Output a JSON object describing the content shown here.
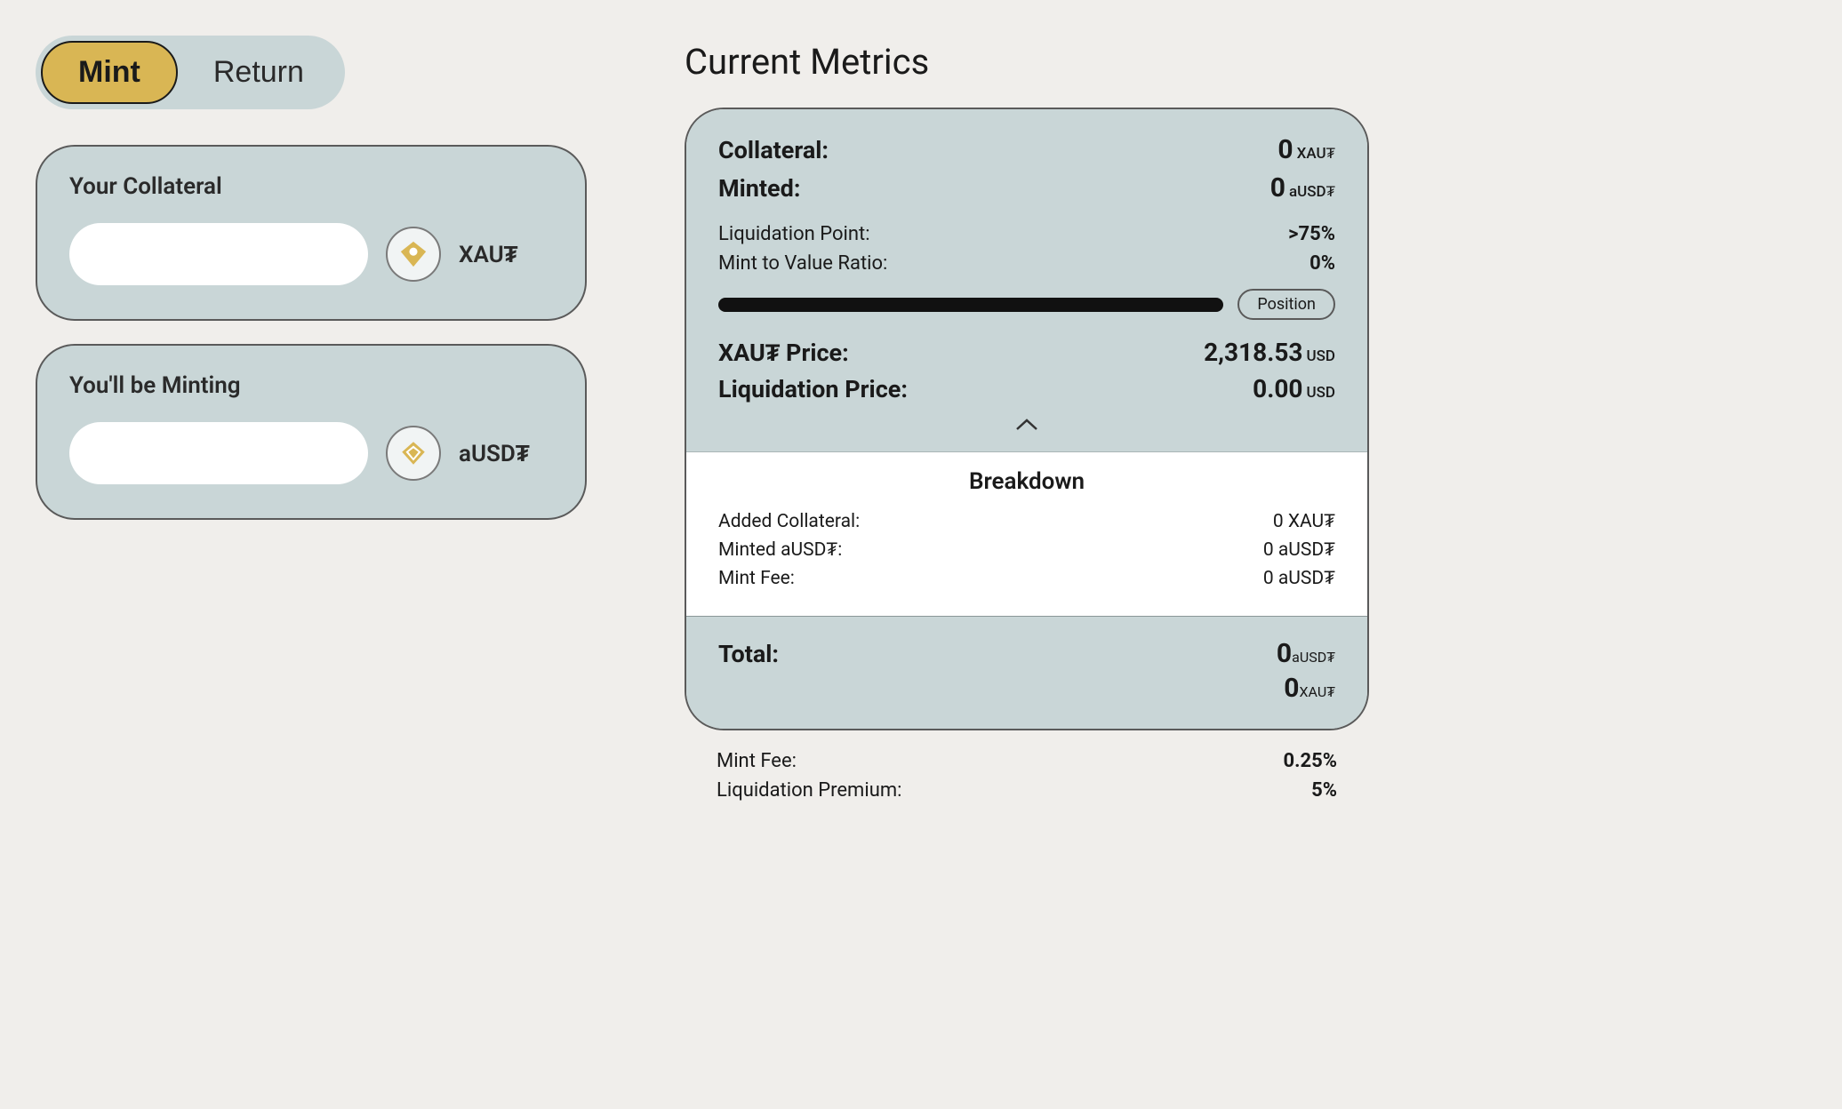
{
  "tabs": {
    "mint": "Mint",
    "return": "Return"
  },
  "collateral_card": {
    "label": "Your Collateral",
    "token": "XAU₮"
  },
  "mint_card": {
    "label": "You'll be Minting",
    "token": "aUSD₮"
  },
  "metrics": {
    "title": "Current Metrics",
    "collateral_label": "Collateral:",
    "collateral_value": "0",
    "collateral_unit": "XAU₮",
    "minted_label": "Minted:",
    "minted_value": "0",
    "minted_unit": "aUSD₮",
    "liq_point_label": "Liquidation Point:",
    "liq_point_value": ">75%",
    "mtv_label": "Mint to Value Ratio:",
    "mtv_value": "0%",
    "position_badge": "Position",
    "xaut_price_label": "XAU₮ Price:",
    "xaut_price_value": "2,318.53",
    "xaut_price_unit": "USD",
    "liq_price_label": "Liquidation Price:",
    "liq_price_value": "0.00",
    "liq_price_unit": "USD"
  },
  "breakdown": {
    "title": "Breakdown",
    "added_collateral_label": "Added Collateral:",
    "added_collateral_value": "0 XAU₮",
    "minted_ausdt_label": "Minted aUSD₮:",
    "minted_ausdt_value": "0 aUSD₮",
    "mint_fee_label": "Mint Fee:",
    "mint_fee_value": "0 aUSD₮"
  },
  "total": {
    "label": "Total:",
    "value1": "0",
    "unit1": "aUSD₮",
    "value2": "0",
    "unit2": "XAU₮"
  },
  "footer": {
    "mint_fee_label": "Mint Fee:",
    "mint_fee_value": "0.25%",
    "liq_premium_label": "Liquidation Premium:",
    "liq_premium_value": "5%"
  }
}
